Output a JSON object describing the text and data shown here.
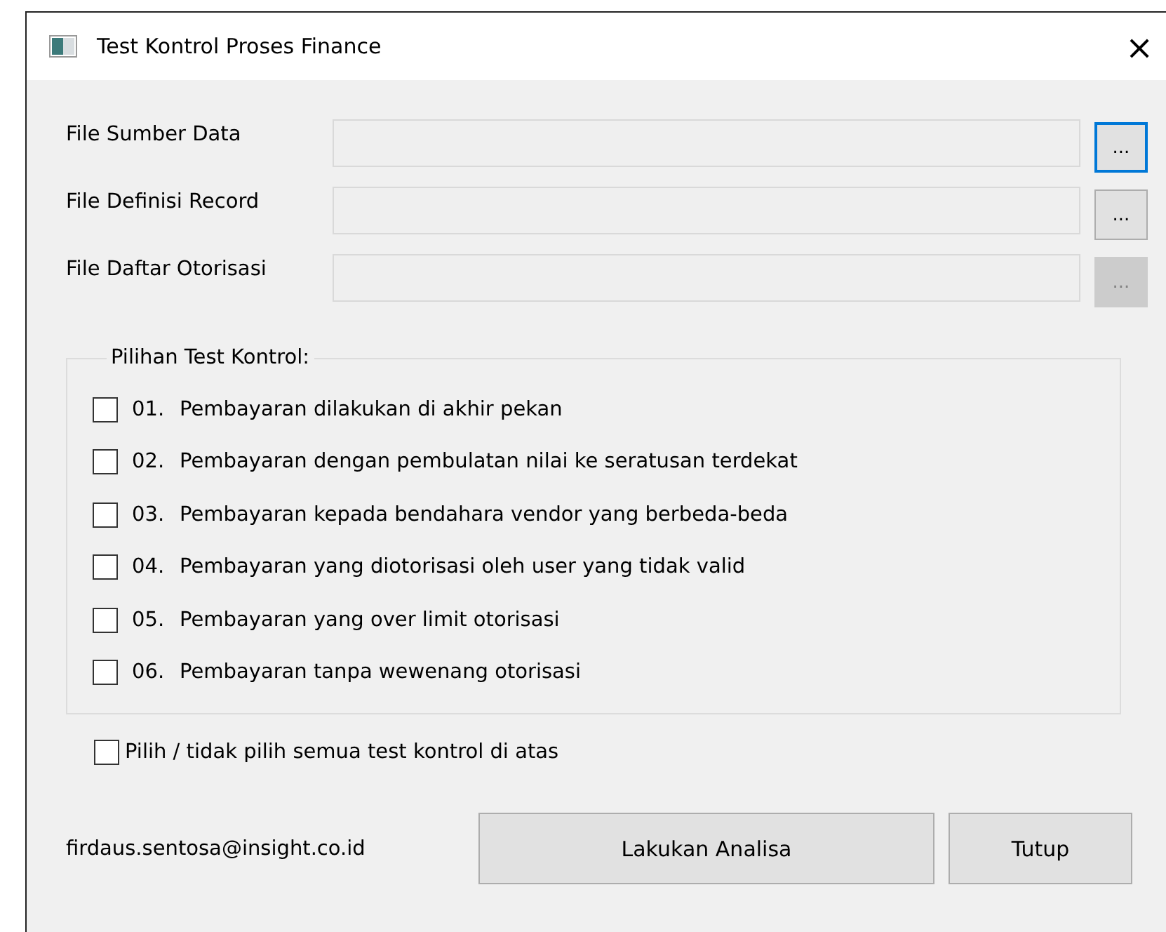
{
  "window": {
    "title": "Test Kontrol Proses Finance",
    "close": "×"
  },
  "file_fields": [
    {
      "label": "File Sumber Data",
      "browse": "...",
      "disabled": false,
      "focused": true
    },
    {
      "label": "File Definisi Record",
      "browse": "...",
      "disabled": false,
      "focused": false
    },
    {
      "label": "File Daftar Otorisasi",
      "browse": "...",
      "disabled": true,
      "focused": false
    }
  ],
  "group": {
    "title": "Pilihan Test Kontrol:",
    "options": [
      {
        "number": "01.",
        "label": "Pembayaran dilakukan di akhir pekan",
        "checked": false
      },
      {
        "number": "02.",
        "label": "Pembayaran dengan pembulatan nilai ke seratusan terdekat",
        "checked": false
      },
      {
        "number": "03.",
        "label": "Pembayaran kepada bendahara vendor yang berbeda-beda",
        "checked": false
      },
      {
        "number": "04.",
        "label": "Pembayaran yang diotorisasi oleh user yang tidak valid",
        "checked": false
      },
      {
        "number": "05.",
        "label": "Pembayaran yang over limit otorisasi",
        "checked": false
      },
      {
        "number": "06.",
        "label": "Pembayaran tanpa wewenang otorisasi",
        "checked": false
      }
    ]
  },
  "select_all": {
    "label": "Pilih / tidak pilih semua test kontrol di atas",
    "checked": false
  },
  "footer": {
    "email": "firdaus.sentosa@insight.co.id",
    "buttons": [
      "Lakukan Analisa",
      "Tutup"
    ]
  }
}
